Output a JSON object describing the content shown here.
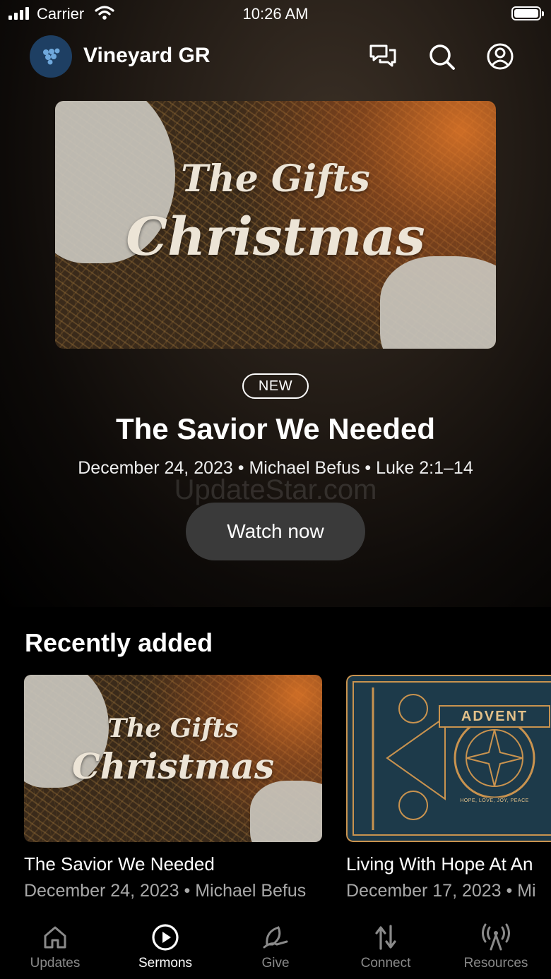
{
  "status_bar": {
    "carrier": "Carrier",
    "time": "10:26 AM"
  },
  "header": {
    "title": "Vineyard GR",
    "icons": [
      "chat-icon",
      "search-icon",
      "profile-icon"
    ]
  },
  "hero": {
    "art_text_line1": "The Gifts",
    "art_text_line2": "Christmas",
    "badge": "NEW",
    "title": "The Savior We Needed",
    "meta": "December 24, 2023 • Michael Befus • Luke 2:1–14",
    "button": "Watch now"
  },
  "watermark": "UpdateStar.com",
  "recently_added": {
    "title": "Recently added",
    "items": [
      {
        "title": "The Savior We Needed",
        "meta": "December 24, 2023 • Michael Befus",
        "art_line1": "The Gifts",
        "art_line2": "Christmas"
      },
      {
        "title": "Living With Hope At An",
        "meta": "December 17, 2023 • Mi",
        "art_label": "ADVENT",
        "art_sub": "HOPE, LOVE, JOY, PEACE"
      }
    ]
  },
  "tabs": [
    {
      "label": "Updates",
      "icon": "home-icon",
      "active": false
    },
    {
      "label": "Sermons",
      "icon": "play-circle-icon",
      "active": true
    },
    {
      "label": "Give",
      "icon": "leaf-hand-icon",
      "active": false
    },
    {
      "label": "Connect",
      "icon": "connect-arrows-icon",
      "active": false
    },
    {
      "label": "Resources",
      "icon": "broadcast-icon",
      "active": false
    }
  ],
  "colors": {
    "background": "#000000",
    "button": "#3a3a3a",
    "muted_text": "#a8a8a8",
    "logo_bg": "#1e3f63",
    "advent_gold": "#c9934f"
  }
}
